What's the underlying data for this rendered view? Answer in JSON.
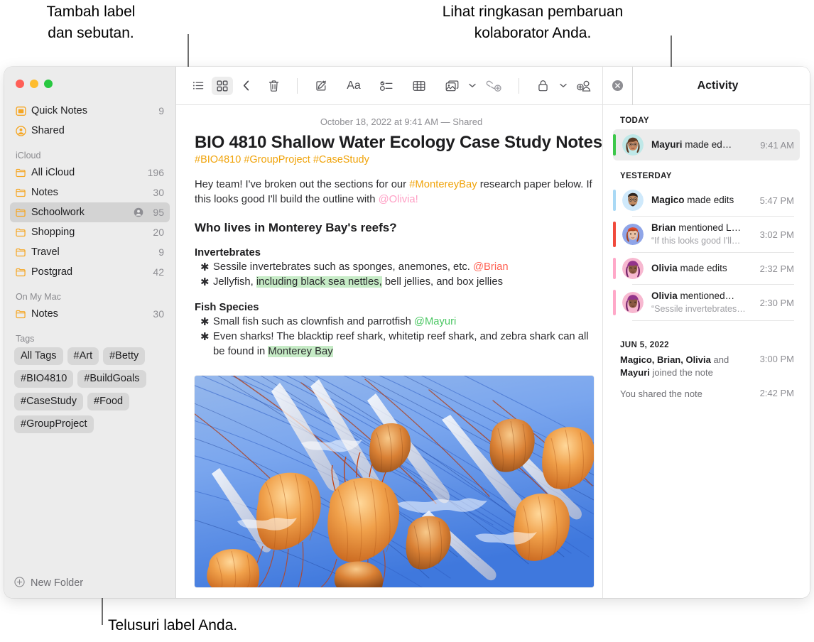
{
  "callouts": {
    "top_left": "Tambah label\ndan sebutan.",
    "top_right": "Lihat ringkasan pembaruan\nkolaborator Anda.",
    "bottom_left": "Telusuri label Anda."
  },
  "window": {
    "traffic_lights": [
      "close",
      "minimize",
      "zoom"
    ]
  },
  "sidebar": {
    "top_items": [
      {
        "icon": "quick-note-icon",
        "label": "Quick Notes",
        "count": "9"
      },
      {
        "icon": "shared-person-icon",
        "label": "Shared",
        "count": ""
      }
    ],
    "sections": [
      {
        "header": "iCloud",
        "items": [
          {
            "icon": "folder-icon",
            "label": "All iCloud",
            "count": "196",
            "shared": false,
            "selected": false
          },
          {
            "icon": "folder-icon",
            "label": "Notes",
            "count": "30",
            "shared": false,
            "selected": false
          },
          {
            "icon": "folder-icon",
            "label": "Schoolwork",
            "count": "95",
            "shared": true,
            "selected": true
          },
          {
            "icon": "folder-icon",
            "label": "Shopping",
            "count": "20",
            "shared": false,
            "selected": false
          },
          {
            "icon": "folder-icon",
            "label": "Travel",
            "count": "9",
            "shared": false,
            "selected": false
          },
          {
            "icon": "folder-icon",
            "label": "Postgrad",
            "count": "42",
            "shared": false,
            "selected": false
          }
        ]
      },
      {
        "header": "On My Mac",
        "items": [
          {
            "icon": "folder-icon",
            "label": "Notes",
            "count": "30",
            "shared": false,
            "selected": false
          }
        ]
      }
    ],
    "tags_header": "Tags",
    "tags": [
      "All Tags",
      "#Art",
      "#Betty",
      "#BIO4810",
      "#BuildGoals",
      "#CaseStudy",
      "#Food",
      "#GroupProject"
    ],
    "new_folder_label": "New Folder"
  },
  "toolbar": {
    "left": [
      {
        "name": "list-view-icon",
        "active": false
      },
      {
        "name": "gallery-view-icon",
        "active": true
      },
      {
        "name": "back-chevron-icon",
        "active": false
      }
    ],
    "right": [
      {
        "name": "trash-icon"
      },
      {
        "name": "compose-icon"
      },
      {
        "name": "format-aa-icon",
        "label": "Aa"
      },
      {
        "name": "checklist-icon"
      },
      {
        "name": "table-icon"
      },
      {
        "name": "media-icon",
        "chevron": true
      },
      {
        "name": "link-add-icon"
      },
      {
        "name": "lock-icon",
        "chevron": true
      },
      {
        "name": "add-collaborator-icon"
      },
      {
        "name": "share-icon"
      },
      {
        "name": "search-icon"
      }
    ]
  },
  "note": {
    "date": "October 18, 2022 at 9:41 AM — Shared",
    "title": "BIO 4810 Shallow Water Ecology Case Study Notes",
    "tags_line": "#BIO4810 #GroupProject #CaseStudy",
    "intro": {
      "a": "Hey team! I've broken out the sections for our ",
      "tag": "#MontereyBay",
      "b": " research paper below. If this looks good I'll build the outline with ",
      "mention": "@Olivia!"
    },
    "heading": "Who lives in Monterey Bay's reefs?",
    "sections": [
      {
        "subheading": "Invertebrates",
        "bullets": [
          {
            "a": "Sessile invertebrates such as sponges, anemones, etc. ",
            "mention": "@Brian",
            "mention_color": "red",
            "b": ""
          },
          {
            "a": "Jellyfish, ",
            "highlight": "including black sea nettles,",
            "b": " bell jellies, and box jellies"
          }
        ]
      },
      {
        "subheading": "Fish Species",
        "bullets": [
          {
            "a": "Small fish such as clownfish and parrotfish ",
            "mention": "@Mayuri",
            "mention_color": "green",
            "b": ""
          },
          {
            "a": "Even sharks! The blacktip reef shark, whitetip reef shark, and zebra shark can all be found in ",
            "highlight": "Monterey Bay",
            "b": ""
          }
        ]
      }
    ],
    "image_alt": "jellyfish-photo"
  },
  "activity": {
    "title": "Activity",
    "close_label": "close-activity",
    "groups": [
      {
        "header": "TODAY",
        "items": [
          {
            "name": "Mayuri",
            "action": " made ed…",
            "quote": "",
            "time": "9:41 AM",
            "bar_color": "#3cc84a",
            "avatar": "mayuri",
            "selected": true
          }
        ]
      },
      {
        "header": "YESTERDAY",
        "items": [
          {
            "name": "Magico",
            "action": " made edits",
            "quote": "",
            "time": "5:47 PM",
            "bar_color": "#a9d9f5",
            "avatar": "magico",
            "selected": false
          },
          {
            "name": "Brian",
            "action": " mentioned L…",
            "quote": "“If this looks good I'll…",
            "time": "3:02 PM",
            "bar_color": "#f04a3c",
            "avatar": "brian",
            "selected": false
          },
          {
            "name": "Olivia",
            "action": " made edits",
            "quote": "",
            "time": "2:32 PM",
            "bar_color": "#ffa8c8",
            "avatar": "olivia",
            "selected": false
          },
          {
            "name": "Olivia",
            "action": " mentioned…",
            "quote": "“Sessile invertebrates…",
            "time": "2:30 PM",
            "bar_color": "#ffa8c8",
            "avatar": "olivia",
            "selected": false
          }
        ]
      }
    ],
    "footer_header": "JUN 5, 2022",
    "footer_rows": [
      {
        "bold1": "Magico, Brian, Olivia",
        "mid": " and ",
        "bold2": "Mayuri",
        "tail": " joined the note",
        "time": "3:00 PM"
      },
      {
        "bold1": "",
        "mid": "You shared the note",
        "bold2": "",
        "tail": "",
        "time": "2:42 PM"
      }
    ]
  },
  "colors": {
    "accent_yellow": "#f0a30a",
    "highlight_green": "#c6ebc6",
    "selected_row": "#d3d3d3"
  }
}
